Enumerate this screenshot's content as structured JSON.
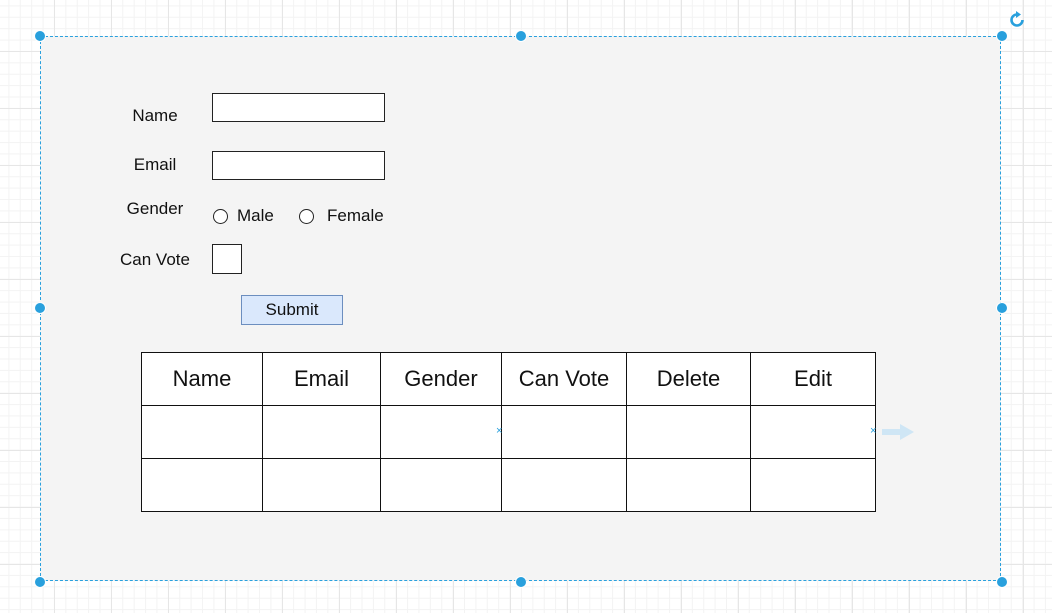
{
  "form": {
    "name_label": "Name",
    "email_label": "Email",
    "gender_label": "Gender",
    "gender_options": [
      "Male",
      "Female"
    ],
    "can_vote_label": "Can Vote",
    "submit_label": "Submit",
    "name_value": "",
    "email_value": ""
  },
  "table": {
    "headers": [
      "Name",
      "Email",
      "Gender",
      "Can Vote",
      "Delete",
      "Edit"
    ],
    "rows": [
      [
        "",
        "",
        "",
        "",
        "",
        ""
      ],
      [
        "",
        "",
        "",
        "",
        "",
        ""
      ]
    ]
  },
  "colors": {
    "selection": "#29a0dd",
    "button_fill": "#dae8fc",
    "button_border": "#6c8ebf",
    "canvas_fill": "#f4f4f4"
  },
  "icons": {
    "rotate": "rotate-icon",
    "connect_arrow": "arrow-right-icon"
  }
}
